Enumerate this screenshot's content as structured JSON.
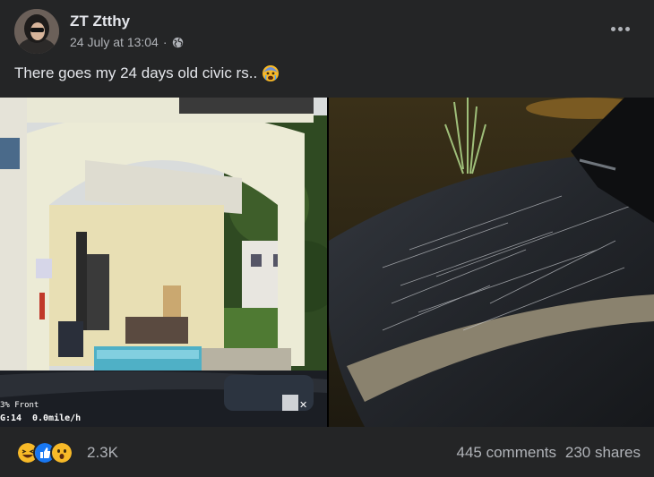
{
  "post": {
    "author": "ZT Ztthy",
    "date": "24 July at 13:04",
    "separator": "·",
    "audience_icon": "globe-icon",
    "caption": "There goes my 24 days old civic rs..",
    "caption_emoji": "fearful-crying-face-emoji"
  },
  "media": {
    "left_photo": {
      "description_icon": "dashcam-photo",
      "overlay_front": "3% Front",
      "overlay_time": "G:14",
      "overlay_speed": "0.0mile/h"
    },
    "right_photo": {
      "description_icon": "scratched-car-photo"
    }
  },
  "stats": {
    "reactions": [
      "haha",
      "like",
      "wow"
    ],
    "reaction_count": "2.3K",
    "comments": "445 comments",
    "shares": "230 shares"
  },
  "colors": {
    "background": "#242526",
    "primary_text": "#e4e6eb",
    "secondary_text": "#b0b3b8",
    "like_blue": "#1877f2",
    "reaction_yellow": "#f7b928"
  }
}
